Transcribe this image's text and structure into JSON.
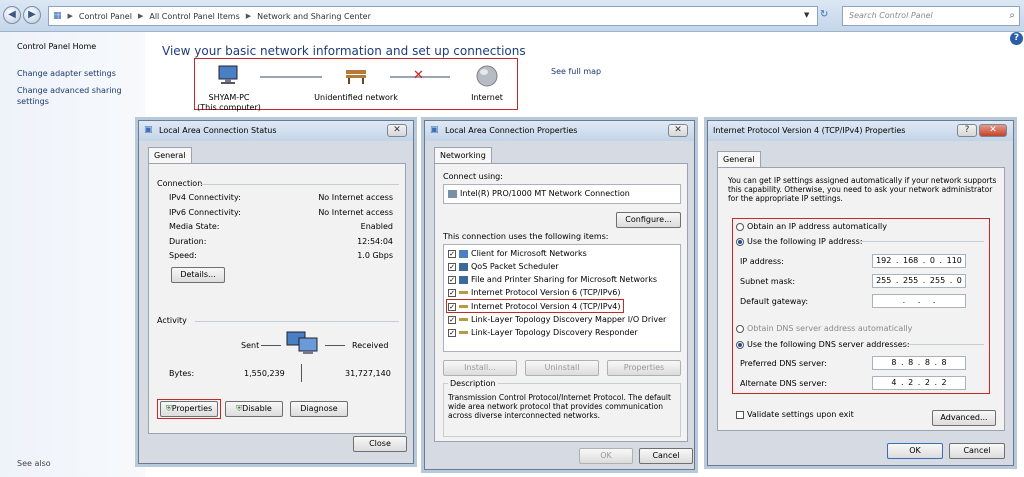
{
  "address_bar": {
    "crumbs": [
      "Control Panel",
      "All Control Panel Items",
      "Network and Sharing Center"
    ],
    "search_placeholder": "Search Control Panel"
  },
  "left_pane": {
    "home": "Control Panel Home",
    "adapter": "Change adapter settings",
    "sharing": "Change advanced sharing settings",
    "see_also": "See also"
  },
  "main": {
    "title": "View your basic network information and set up connections",
    "see_full_map": "See full map",
    "computer_name": "SHYAM-PC",
    "computer_sub": "(This computer)",
    "network": "Unidentified network",
    "internet": "Internet"
  },
  "status_dialog": {
    "title": "Local Area Connection Status",
    "tab": "General",
    "connection_header": "Connection",
    "rows": [
      {
        "label": "IPv4 Connectivity:",
        "value": "No Internet access"
      },
      {
        "label": "IPv6 Connectivity:",
        "value": "No Internet access"
      },
      {
        "label": "Media State:",
        "value": "Enabled"
      },
      {
        "label": "Duration:",
        "value": "12:54:04"
      },
      {
        "label": "Speed:",
        "value": "1.0 Gbps"
      }
    ],
    "details": "Details...",
    "activity_header": "Activity",
    "sent": "Sent",
    "received": "Received",
    "bytes_label": "Bytes:",
    "bytes_sent": "1,550,239",
    "bytes_received": "31,727,140",
    "properties": "Properties",
    "disable": "Disable",
    "diagnose": "Diagnose",
    "close": "Close"
  },
  "props_dialog": {
    "title": "Local Area Connection Properties",
    "tab": "Networking",
    "connect_using": "Connect using:",
    "adapter": "Intel(R) PRO/1000 MT Network Connection",
    "configure": "Configure...",
    "items_label": "This connection uses the following items:",
    "items": [
      "Client for Microsoft Networks",
      "QoS Packet Scheduler",
      "File and Printer Sharing for Microsoft Networks",
      "Internet Protocol Version 6 (TCP/IPv6)",
      "Internet Protocol Version 4 (TCP/IPv4)",
      "Link-Layer Topology Discovery Mapper I/O Driver",
      "Link-Layer Topology Discovery Responder"
    ],
    "install": "Install...",
    "uninstall": "Uninstall",
    "properties": "Properties",
    "description_header": "Description",
    "description": "Transmission Control Protocol/Internet Protocol. The default wide area network protocol that provides communication across diverse interconnected networks.",
    "ok": "OK",
    "cancel": "Cancel"
  },
  "ipv4_dialog": {
    "title": "Internet Protocol Version 4 (TCP/IPv4) Properties",
    "help": "?",
    "tab": "General",
    "intro": "You can get IP settings assigned automatically if your network supports this capability. Otherwise, you need to ask your network administrator for the appropriate IP settings.",
    "obtain_ip": "Obtain an IP address automatically",
    "use_ip": "Use the following IP address:",
    "ip_label": "IP address:",
    "ip_value": "192 . 168 . 0 . 110",
    "mask_label": "Subnet mask:",
    "mask_value": "255 . 255 . 255 . 0",
    "gateway_label": "Default gateway:",
    "gateway_value": ". . .",
    "obtain_dns": "Obtain DNS server address automatically",
    "use_dns": "Use the following DNS server addresses:",
    "pref_dns_label": "Preferred DNS server:",
    "pref_dns_value": "8 . 8 . 8 . 8",
    "alt_dns_label": "Alternate DNS server:",
    "alt_dns_value": "4 . 2 . 2 . 2",
    "validate": "Validate settings upon exit",
    "advanced": "Advanced...",
    "ok": "OK",
    "cancel": "Cancel"
  },
  "colors": {
    "highlight_red": "#c62828",
    "link_blue": "#1a3a6e"
  }
}
